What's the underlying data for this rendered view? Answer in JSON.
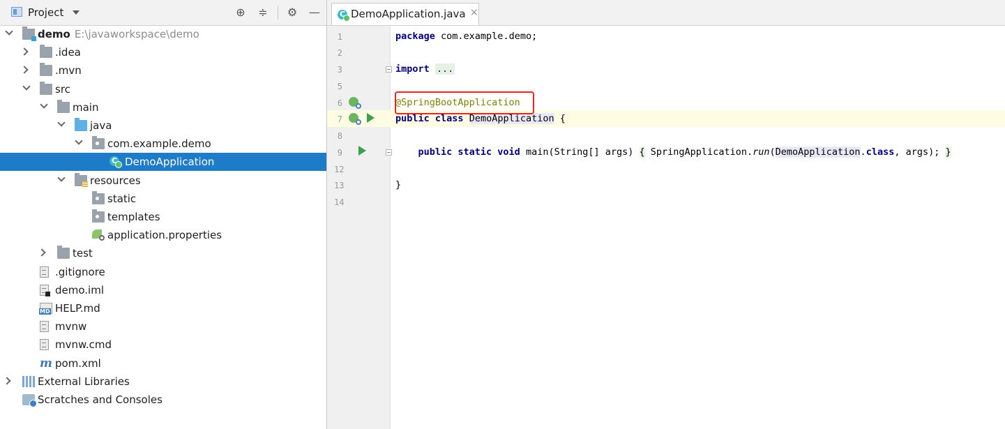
{
  "project_panel": {
    "title": "Project",
    "tools": [
      "target-icon",
      "collapse-icon",
      "gear-icon",
      "minimize-icon"
    ],
    "tree": [
      {
        "label": "demo",
        "hint": "E:\\javaworkspace\\demo",
        "level": 0,
        "expanded": true,
        "icon": "module-folder-icon"
      },
      {
        "label": ".idea",
        "level": 1,
        "expanded": false,
        "icon": "folder-icon"
      },
      {
        "label": ".mvn",
        "level": 1,
        "expanded": false,
        "icon": "folder-icon"
      },
      {
        "label": "src",
        "level": 1,
        "expanded": true,
        "icon": "folder-icon"
      },
      {
        "label": "main",
        "level": 2,
        "expanded": true,
        "icon": "folder-icon"
      },
      {
        "label": "java",
        "level": 3,
        "expanded": true,
        "icon": "source-folder-icon"
      },
      {
        "label": "com.example.demo",
        "level": 4,
        "expanded": true,
        "icon": "package-icon"
      },
      {
        "label": "DemoApplication",
        "level": 5,
        "selected": true,
        "icon": "spring-class-icon"
      },
      {
        "label": "resources",
        "level": 3,
        "expanded": true,
        "icon": "resources-folder-icon"
      },
      {
        "label": "static",
        "level": 4,
        "icon": "package-icon"
      },
      {
        "label": "templates",
        "level": 4,
        "icon": "package-icon"
      },
      {
        "label": "application.properties",
        "level": 4,
        "icon": "properties-icon"
      },
      {
        "label": "test",
        "level": 2,
        "expanded": false,
        "icon": "folder-icon"
      },
      {
        "label": ".gitignore",
        "level": 1,
        "icon": "text-file-icon"
      },
      {
        "label": "demo.iml",
        "level": 1,
        "icon": "iml-file-icon"
      },
      {
        "label": "HELP.md",
        "level": 1,
        "icon": "markdown-icon"
      },
      {
        "label": "mvnw",
        "level": 1,
        "icon": "text-file-icon"
      },
      {
        "label": "mvnw.cmd",
        "level": 1,
        "icon": "text-file-icon"
      },
      {
        "label": "pom.xml",
        "level": 1,
        "icon": "maven-icon"
      },
      {
        "label": "External Libraries",
        "level": 0,
        "expanded": false,
        "icon": "libraries-icon"
      },
      {
        "label": "Scratches and Consoles",
        "level": 0,
        "icon": "scratches-icon"
      }
    ]
  },
  "editor": {
    "tab_label": "DemoApplication.java",
    "tab_close": "×",
    "line_numbers": [
      "1",
      "2",
      "3",
      "5",
      "6",
      "7",
      "8",
      "9",
      "12",
      "13",
      "14"
    ],
    "code": {
      "l1_kw": "package",
      "l1_rest": " com.example.demo;",
      "l3_kw": "import",
      "l3_fold": "...",
      "l6_ann": "@SpringBootApplication",
      "l7_kw": "public class",
      "l7_name": "DemoApplication",
      "l7_rest": " {",
      "l9_indent": "    ",
      "l9_kw": "public static void",
      "l9_sig": " main(String[] args) ",
      "l9_open": "{",
      "l9_call": " SpringApplication.",
      "l9_run": "run",
      "l9_paren": "(",
      "l9_cls": "DemoApplication",
      "l9_dot": ".",
      "l9_classkw": "class",
      "l9_args": ", args); ",
      "l9_close": "}",
      "l13": "}"
    }
  },
  "colors": {
    "selection": "#1e7bc7",
    "keyword": "#000080",
    "annotation": "#808000",
    "highlight_box": "#e8281f",
    "caret_line": "#fefce3"
  }
}
